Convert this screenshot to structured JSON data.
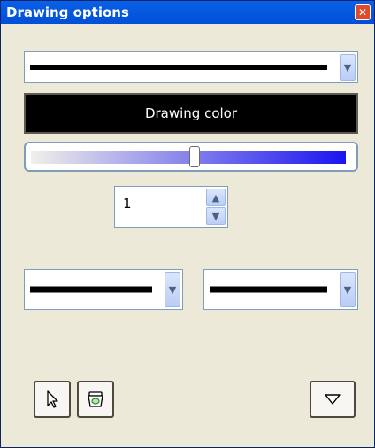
{
  "window": {
    "title": "Drawing options"
  },
  "main": {
    "line_width_select": {
      "icon": "thick-line-sample"
    },
    "color_button": {
      "label": "Drawing color",
      "color": "#000000"
    },
    "opacity_slider": {
      "value": 0.52,
      "gradient": [
        "#f1f0e8",
        "#1a14f0"
      ]
    },
    "size_spinner": {
      "value": "1"
    },
    "start_line_select": {
      "icon": "thick-line-sample"
    },
    "end_line_select": {
      "icon": "thick-line-sample"
    }
  },
  "toolbar": {
    "pointer_icon": "pointer-icon",
    "eraser_icon": "eraser-icon",
    "collapse_icon": "triangle-down-icon"
  }
}
